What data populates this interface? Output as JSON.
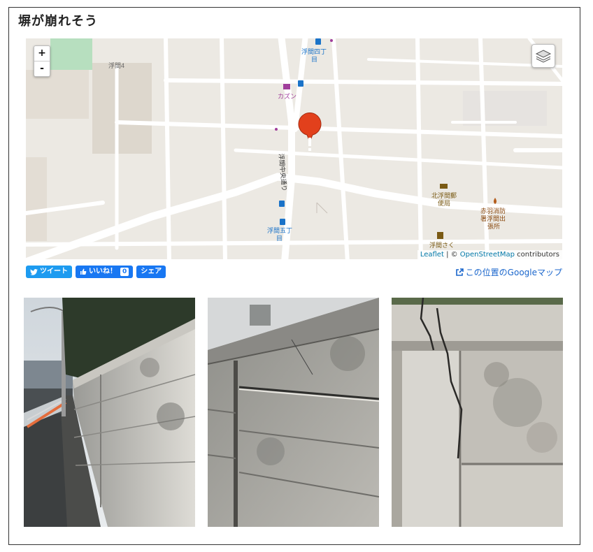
{
  "title": "塀が崩れそう",
  "map": {
    "zoom_in": "+",
    "zoom_out": "-",
    "labels": {
      "area": "浮間4",
      "bus_stop_north": "浮間四丁\n目",
      "shop": "カズン",
      "street": "浮間中央通り",
      "post_office": "北浮間郵\n便局",
      "fire_station": "赤羽消防\n署浮間出\n張所",
      "bus_stop_south": "浮間五丁\n目",
      "nursery": "浮間さく"
    },
    "attribution": {
      "leaflet": "Leaflet",
      "sep": " | © ",
      "osm": "OpenStreetMap",
      "suffix": " contributors"
    }
  },
  "social": {
    "tweet": "ツイート",
    "like": "いいね！",
    "like_count": "0",
    "share": "シェア"
  },
  "google_map_link": "この位置のGoogleマップ",
  "colors": {
    "marker": "#e2401c",
    "tweet": "#1d9bf0",
    "facebook": "#1877f2",
    "link": "#1a66cc"
  }
}
